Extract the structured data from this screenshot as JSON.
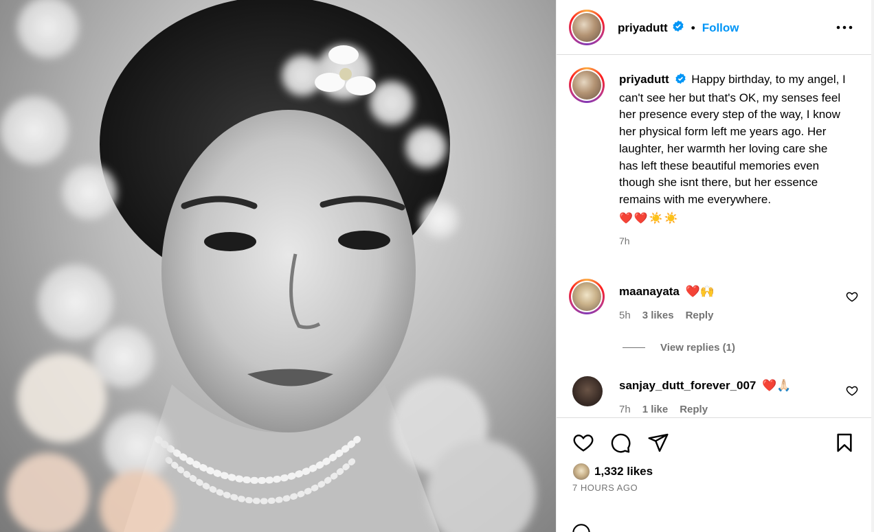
{
  "post": {
    "username": "priyadutt",
    "separator": "•",
    "follow_label": "Follow",
    "more_icon": "more-options-icon",
    "caption": "Happy birthday, to my angel, I can't see her but that's OK, my senses feel her presence every step of the way, I know her physical form left me years ago. Her laughter, her warmth her loving care she has left these beautiful memories even though she isnt there, but her essence remains with me everywhere.",
    "caption_emojis": "❤️❤️☀️☀️",
    "caption_time": "7h",
    "likes_count": "1,332 likes",
    "posted_ago": "7 HOURS AGO"
  },
  "comments": [
    {
      "username": "maanayata",
      "text": "❤️🙌",
      "time": "5h",
      "likes": "3 likes",
      "reply_label": "Reply",
      "view_replies": "View replies (1)"
    },
    {
      "username": "sanjay_dutt_forever_007",
      "text": "❤️🙏🏻",
      "time": "7h",
      "likes": "1 like",
      "reply_label": "Reply"
    }
  ],
  "colors": {
    "accent": "#0095f6",
    "muted": "#737373",
    "verified": "#0095f6",
    "heart": "#e0102b"
  }
}
